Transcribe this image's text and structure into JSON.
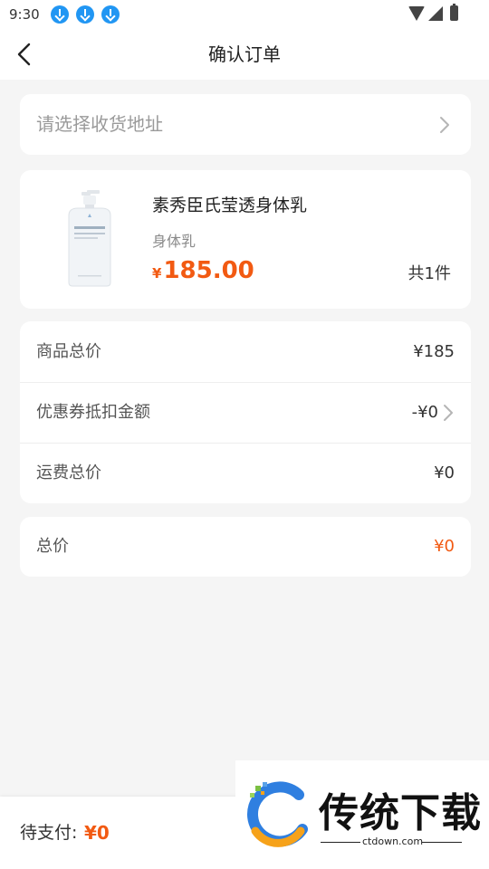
{
  "status_bar": {
    "time": "9:30",
    "icons": [
      "download-icon",
      "download-icon",
      "download-icon",
      "wifi-icon",
      "signal-icon",
      "battery-icon"
    ]
  },
  "header": {
    "title": "确认订单",
    "back_icon": "chevron-left-icon"
  },
  "address": {
    "placeholder": "请选择收货地址",
    "icon": "chevron-right-icon"
  },
  "product": {
    "name": "素秀臣氏莹透身体乳",
    "spec": "身体乳",
    "price_symbol": "¥",
    "price": "185.00",
    "quantity": "共1件",
    "image_icon": "lotion-bottle-image"
  },
  "summary": {
    "rows": [
      {
        "label": "商品总价",
        "value": "¥185"
      },
      {
        "label": "优惠券抵扣金额",
        "value": "-¥0"
      },
      {
        "label": "运费总价",
        "value": "¥0"
      }
    ]
  },
  "total": {
    "label": "总价",
    "value": "¥0"
  },
  "bottom_bar": {
    "pay_label": "待支付:",
    "pay_amount": "¥0"
  },
  "watermark": {
    "title": "传统下载",
    "domain": "ctdown.com"
  },
  "colors": {
    "accent": "#f25a12",
    "background": "#f5f5f5",
    "card": "#ffffff",
    "status_icon": "#2196f3"
  }
}
